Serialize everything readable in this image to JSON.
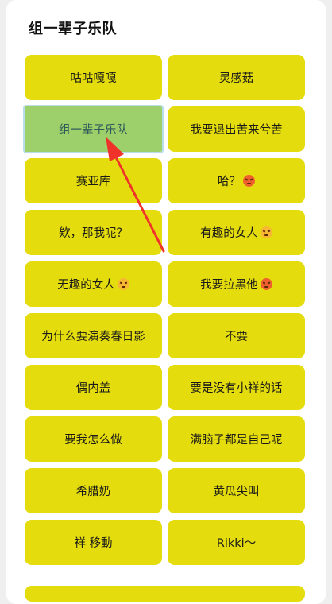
{
  "title": "组一辈子乐队",
  "options": [
    {
      "label": "咕咕嘎嘎",
      "emoji": ""
    },
    {
      "label": "灵感菇",
      "emoji": ""
    },
    {
      "label": "组一辈子乐队",
      "emoji": ""
    },
    {
      "label": "我要退出苦来兮苦",
      "emoji": ""
    },
    {
      "label": "赛亚库",
      "emoji": ""
    },
    {
      "label": "哈？",
      "emoji": "angry-face-icon"
    },
    {
      "label": "欸，那我呢？",
      "emoji": ""
    },
    {
      "label": "有趣的女人",
      "emoji": "smirk-face-icon"
    },
    {
      "label": "无趣的女人",
      "emoji": "angry-face-icon"
    },
    {
      "label": "我要拉黑他",
      "emoji": "angry-face-red-icon"
    },
    {
      "label": "为什么要演奏春日影",
      "emoji": ""
    },
    {
      "label": "不要",
      "emoji": ""
    },
    {
      "label": "偶内盖",
      "emoji": ""
    },
    {
      "label": "要是没有小祥的话",
      "emoji": ""
    },
    {
      "label": "要我怎么做",
      "emoji": ""
    },
    {
      "label": "满脑子都是自己呢",
      "emoji": ""
    },
    {
      "label": "希腊奶",
      "emoji": ""
    },
    {
      "label": "黄瓜尖叫",
      "emoji": ""
    },
    {
      "label": "祥 移動",
      "emoji": ""
    },
    {
      "label": "Rikki～",
      "emoji": ""
    }
  ],
  "selected_option": "组一辈子乐队",
  "colors": {
    "option_bg": "#e4dc0c",
    "selected_bg": "#9dcf6a",
    "arrow": "#f0332a"
  }
}
